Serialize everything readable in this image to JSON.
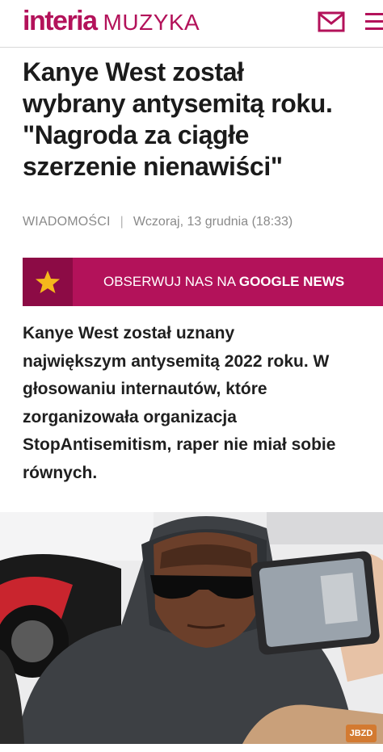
{
  "header": {
    "logo_brand": "interia",
    "logo_section": "MUZYKA",
    "mail_icon": "mail-icon",
    "menu_icon": "hamburger-menu-icon"
  },
  "article": {
    "headline_lines": [
      "Kanye West został",
      "wybrany antysemitą roku.",
      "\"Nagroda za ciągłe",
      "szerzenie nienawiści\""
    ],
    "category": "WIADOMOŚCI",
    "date": "Wczoraj, 13 grudnia (18:33)",
    "lead_lines": [
      "Kanye West został uznany",
      "największym antysemitą 2022 roku. W",
      "głosowaniu internautów, które",
      "zorganizowała organizacja",
      "StopAntisemitism, raper nie miał sobie",
      "równych."
    ]
  },
  "banner": {
    "prefix": "OBSERWUJ NAS NA ",
    "highlight": "GOOGLE NEWS",
    "icon": "star-icon"
  },
  "photo": {
    "watermark": "JBZD"
  },
  "colors": {
    "brand": "#b3125a",
    "brand_dark": "#8c0b45",
    "star": "#f5b81c"
  }
}
